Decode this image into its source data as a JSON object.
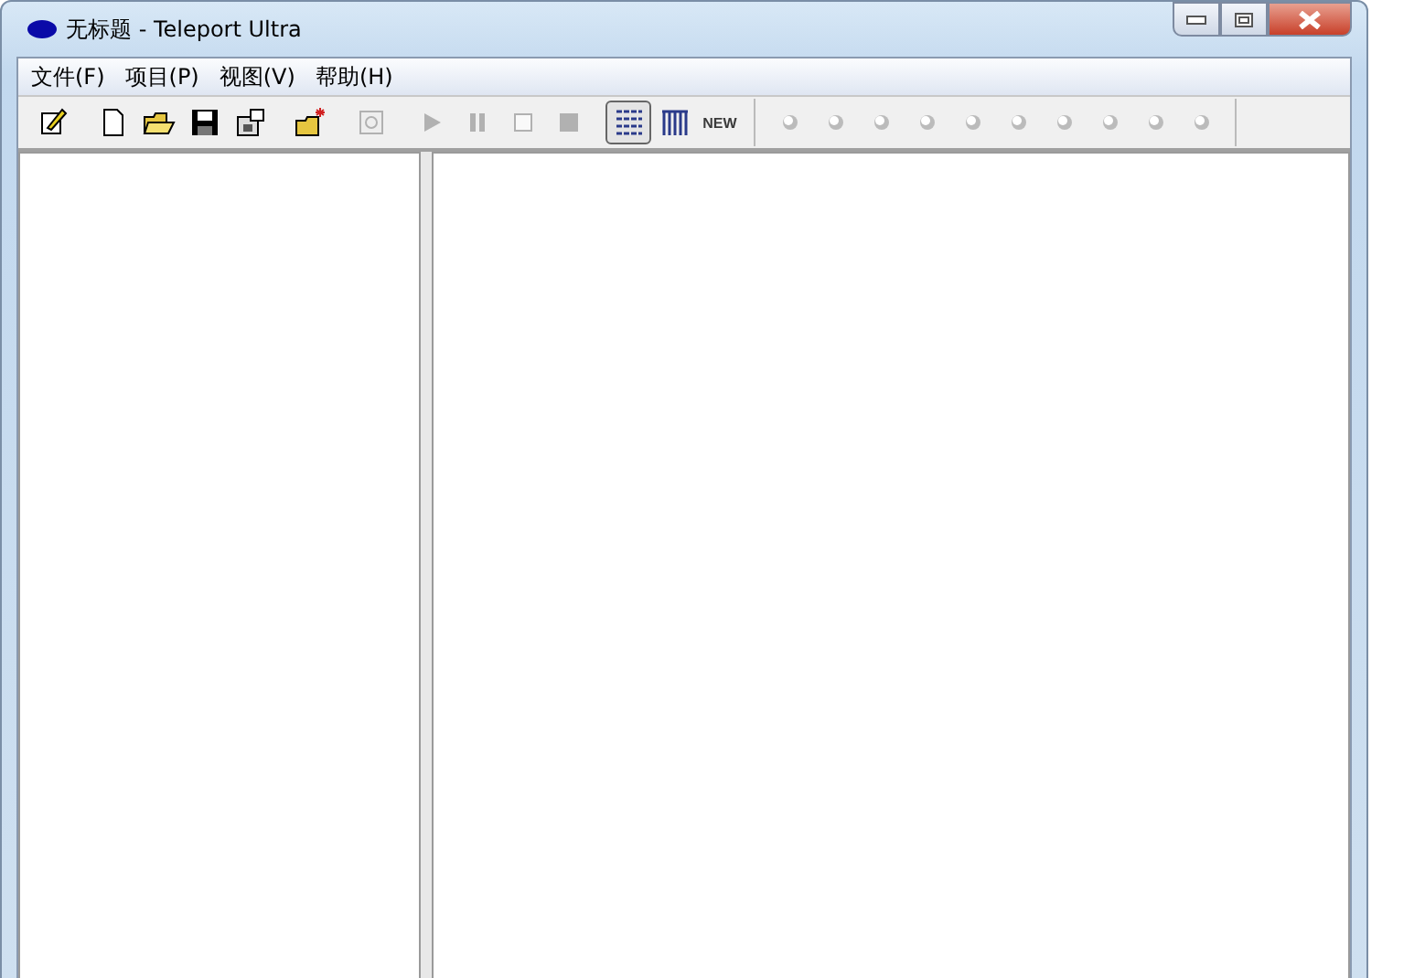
{
  "window": {
    "title": "无标题 - Teleport Ultra"
  },
  "menu": [
    {
      "label": "文件(F)"
    },
    {
      "label": "项目(P)"
    },
    {
      "label": "视图(V)"
    },
    {
      "label": "帮助(H)"
    }
  ],
  "toolbar": [
    {
      "kind": "edit",
      "disabled": false,
      "selected": false
    },
    {
      "kind": "gap"
    },
    {
      "kind": "new",
      "disabled": false,
      "selected": false
    },
    {
      "kind": "open",
      "disabled": false,
      "selected": false
    },
    {
      "kind": "save",
      "disabled": false,
      "selected": false
    },
    {
      "kind": "properties",
      "disabled": false,
      "selected": false
    },
    {
      "kind": "gap"
    },
    {
      "kind": "folder-spark",
      "disabled": false,
      "selected": false
    },
    {
      "kind": "gap"
    },
    {
      "kind": "browse",
      "disabled": true,
      "selected": false
    },
    {
      "kind": "gap"
    },
    {
      "kind": "play",
      "disabled": true,
      "selected": false
    },
    {
      "kind": "pause",
      "disabled": true,
      "selected": false
    },
    {
      "kind": "square",
      "disabled": true,
      "selected": false
    },
    {
      "kind": "stop",
      "disabled": true,
      "selected": false
    },
    {
      "kind": "gap"
    },
    {
      "kind": "list-view",
      "disabled": false,
      "selected": true
    },
    {
      "kind": "grid-view",
      "disabled": false,
      "selected": false
    },
    {
      "kind": "new-badge",
      "label": "NEW",
      "disabled": false,
      "selected": false
    },
    {
      "kind": "separator"
    },
    {
      "kind": "light",
      "disabled": false,
      "selected": false
    },
    {
      "kind": "light",
      "disabled": false,
      "selected": false
    },
    {
      "kind": "light",
      "disabled": false,
      "selected": false
    },
    {
      "kind": "light",
      "disabled": false,
      "selected": false
    },
    {
      "kind": "light",
      "disabled": false,
      "selected": false
    },
    {
      "kind": "light",
      "disabled": false,
      "selected": false
    },
    {
      "kind": "light",
      "disabled": false,
      "selected": false
    },
    {
      "kind": "light",
      "disabled": false,
      "selected": false
    },
    {
      "kind": "light",
      "disabled": false,
      "selected": false
    },
    {
      "kind": "light",
      "disabled": false,
      "selected": false
    },
    {
      "kind": "separator"
    }
  ]
}
